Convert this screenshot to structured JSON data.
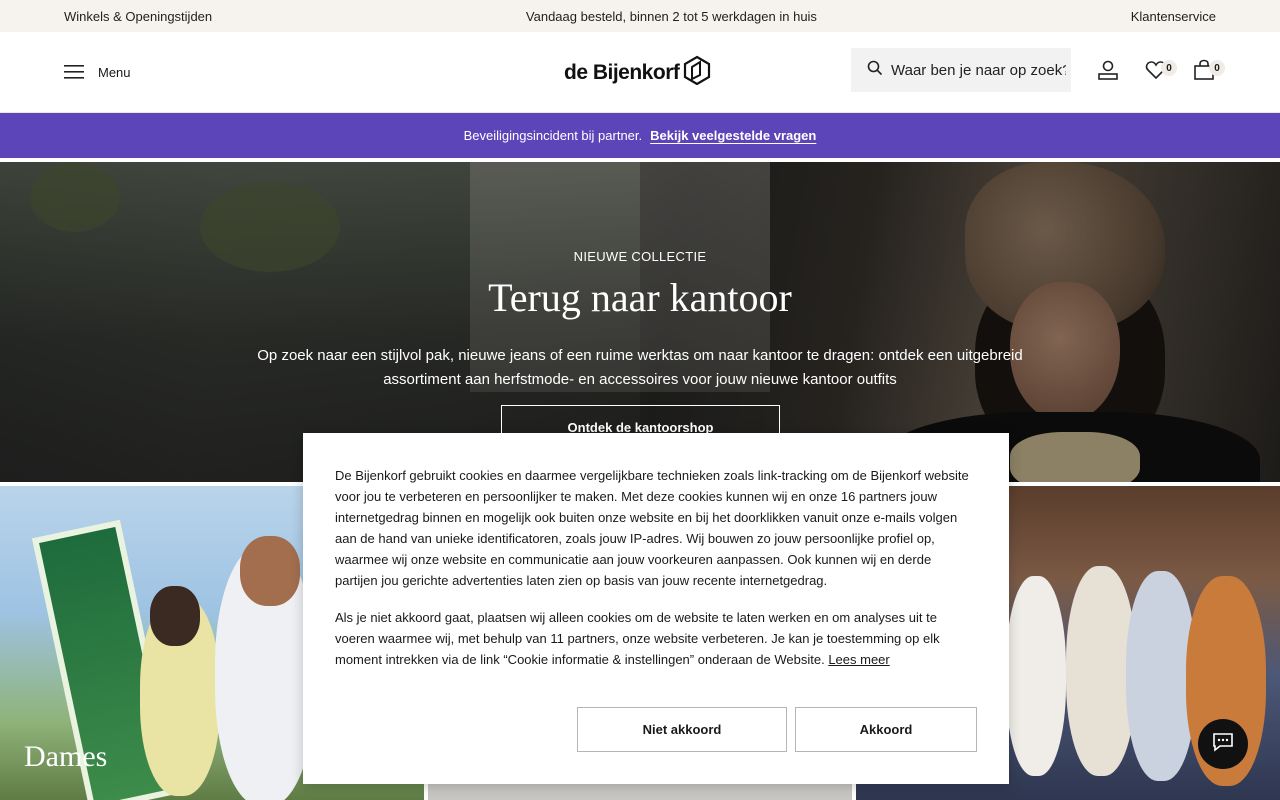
{
  "topbar": {
    "stores": "Winkels & Openingstijden",
    "delivery": "Vandaag besteld, binnen 2 tot 5 werkdagen in huis",
    "service": "Klantenservice"
  },
  "header": {
    "menu_label": "Menu",
    "logo_text": "de Bijenkorf",
    "search_placeholder": "Waar ben je naar op zoek?",
    "wishlist_count": "0",
    "cart_count": "0",
    "icons": [
      "hamburger-icon",
      "search-icon",
      "account-icon",
      "heart-icon",
      "bag-icon",
      "logo-mark-icon"
    ]
  },
  "alert": {
    "text": "Beveiligingsincident bij partner.",
    "link": "Bekijk veelgestelde vragen",
    "color": "#5c45b8"
  },
  "hero": {
    "kicker": "NIEUWE COLLECTIE",
    "title": "Terug naar kantoor",
    "description": "Op zoek naar een stijlvol pak, nieuwe jeans of een ruime werktas om naar kantoor te dragen: ontdek een uitgebreid assortiment aan herfstmode- en accessoires voor jouw nieuwe kantoor outfits",
    "cta": "Ontdek de kantoorshop"
  },
  "tiles": {
    "dames_label": "Dames"
  },
  "cookie": {
    "paragraph1": "De Bijenkorf gebruikt cookies en daarmee vergelijkbare technieken zoals link-tracking om de Bijenkorf website voor jou te verbeteren en persoonlijker te maken. Met deze cookies kunnen wij en onze 16 partners jouw internetgedrag binnen en mogelijk ook buiten onze website en bij het doorklikken vanuit onze e-mails volgen aan de hand van unieke identificatoren, zoals jouw IP-adres. Wij bouwen zo jouw persoonlijke profiel op, waarmee wij onze website en communicatie aan jouw voorkeuren aanpassen. Ook kunnen wij en derde partijen jou gerichte advertenties laten zien op basis van jouw recente internetgedrag.",
    "paragraph2": "Als je niet akkoord gaat, plaatsen wij alleen cookies om de website te laten werken en om analyses uit te voeren waarmee wij, met behulp van 11 partners, onze website verbeteren. Je kan je toestemming op elk moment intrekken via de link “Cookie informatie & instellingen” onderaan de Website.",
    "more_link": "Lees meer",
    "decline": "Niet akkoord",
    "accept": "Akkoord"
  },
  "chat": {
    "icon": "chat-icon"
  }
}
